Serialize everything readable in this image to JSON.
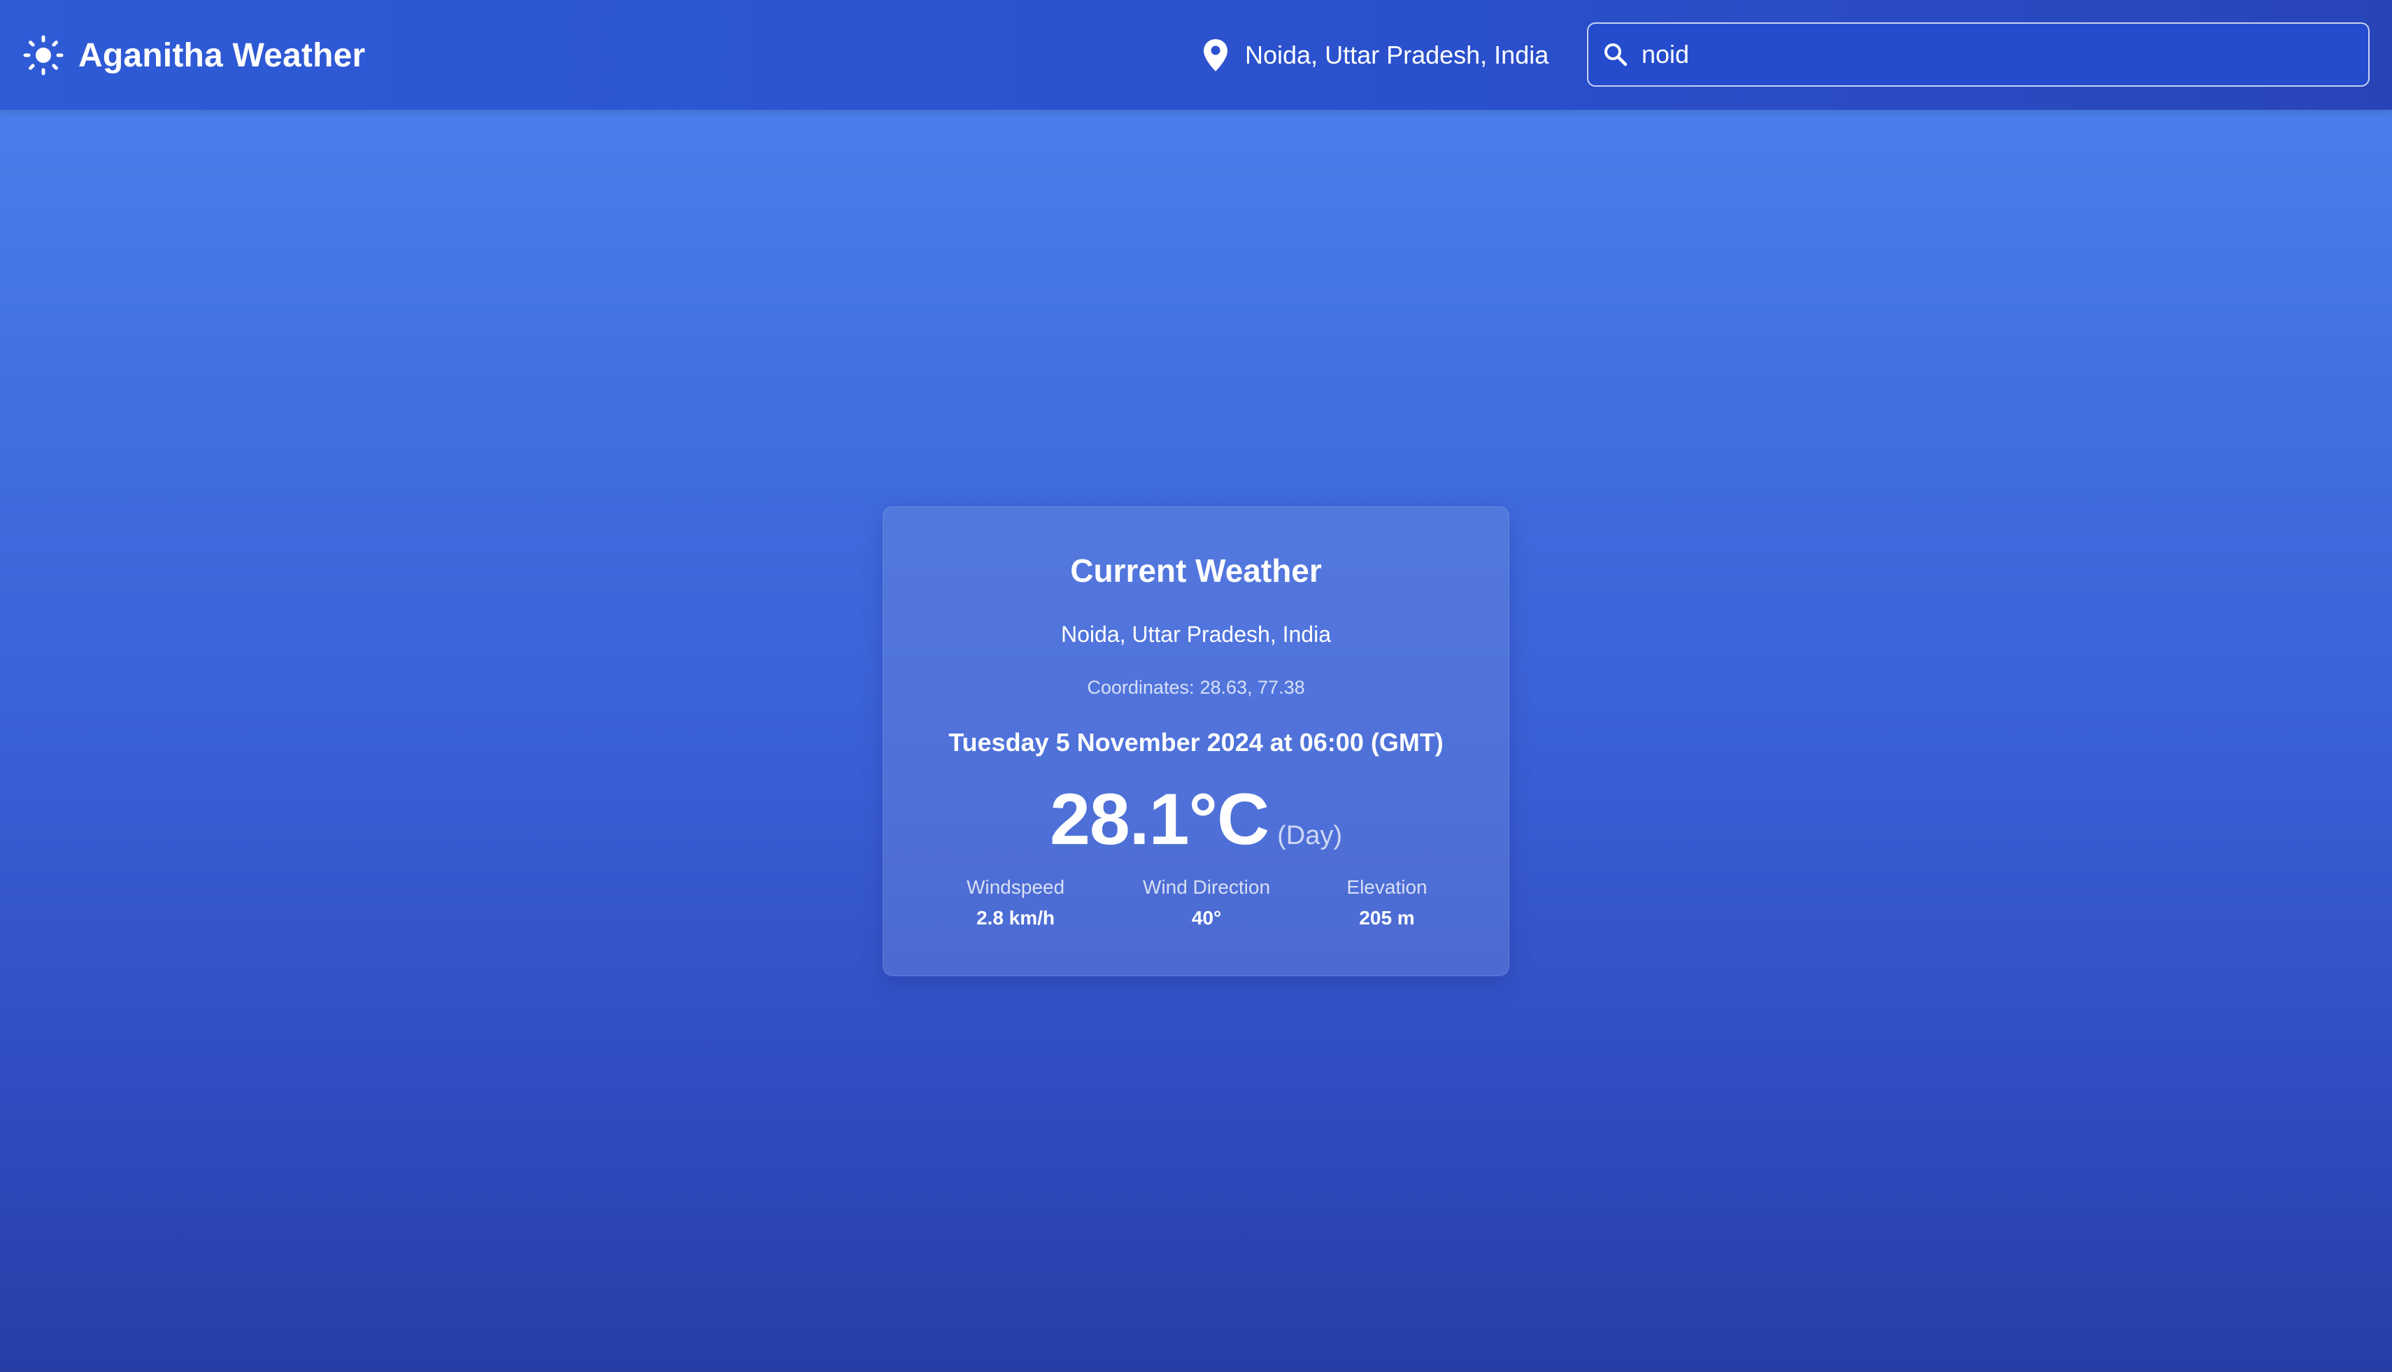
{
  "app": {
    "title": "Aganitha Weather",
    "logo_icon": "sun-icon"
  },
  "header": {
    "location_icon": "location-pin-icon",
    "location": "Noida, Uttar Pradesh, India",
    "search": {
      "icon": "search-icon",
      "value": "noid",
      "placeholder": ""
    }
  },
  "weather_card": {
    "heading": "Current Weather",
    "place": "Noida, Uttar Pradesh, India",
    "coordinates_label": "Coordinates:",
    "coordinates": "28.63, 77.38",
    "datetime": "Tuesday 5 November 2024 at 06:00 (GMT)",
    "temperature": "28.1°C",
    "period": "(Day)",
    "stats": [
      {
        "label": "Windspeed",
        "value": "2.8 km/h"
      },
      {
        "label": "Wind Direction",
        "value": "40°"
      },
      {
        "label": "Elevation",
        "value": "205 m"
      }
    ]
  },
  "colors": {
    "header_bg": "#2c52cf",
    "page_top": "#4f85ef",
    "page_bottom": "#263ea6",
    "text": "#ffffff"
  }
}
